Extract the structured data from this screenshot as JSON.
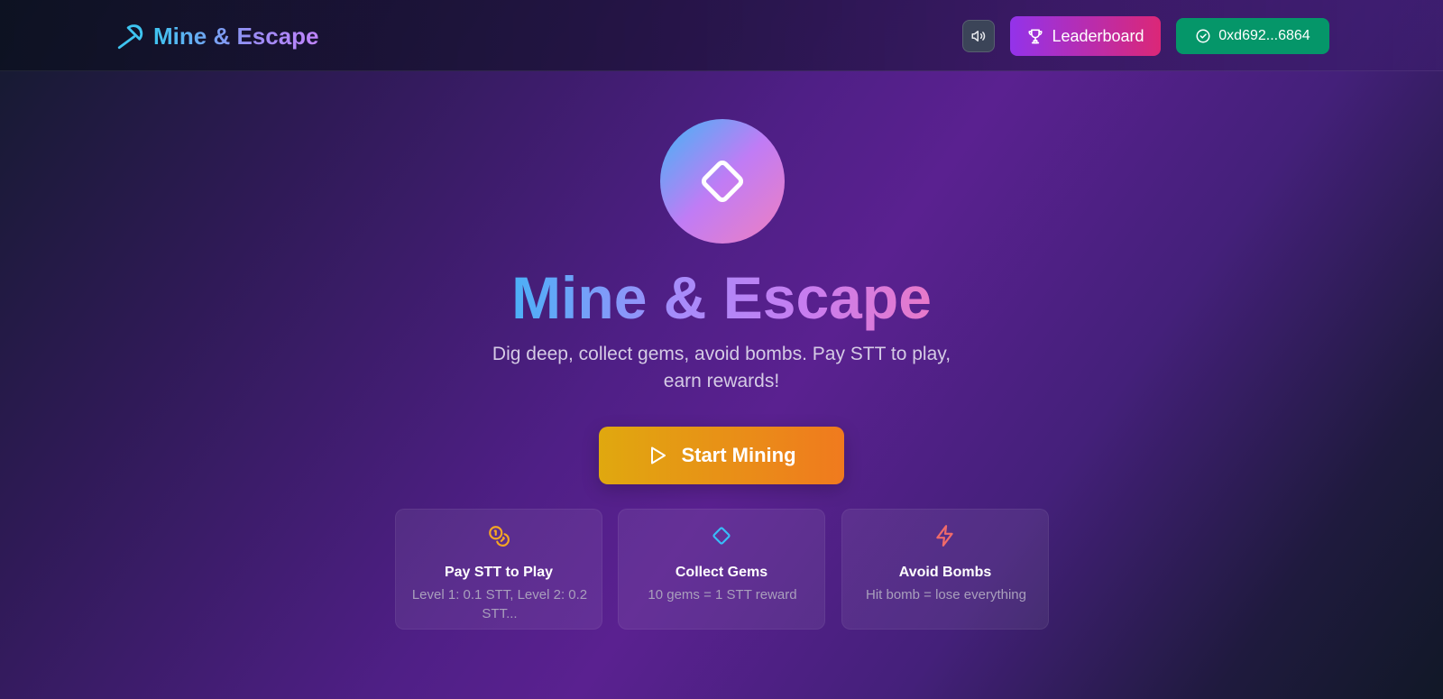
{
  "header": {
    "brand_title": "Mine & Escape",
    "brand_icon": "pickaxe-icon",
    "sound_icon": "speaker-icon",
    "leaderboard_label": "Leaderboard",
    "leaderboard_icon": "trophy-icon",
    "wallet_label": "0xd692...6864",
    "wallet_icon": "check-circle-icon"
  },
  "hero": {
    "logo_icon": "diamond-icon",
    "title": "Mine & Escape",
    "subtitle": "Dig deep, collect gems, avoid bombs. Pay STT to play, earn rewards!",
    "start_button_label": "Start Mining",
    "start_button_icon": "play-icon"
  },
  "features": [
    {
      "icon": "coins-icon",
      "title": "Pay STT to Play",
      "description": "Level 1: 0.1 STT, Level 2: 0.2 STT..."
    },
    {
      "icon": "gem-icon",
      "title": "Collect Gems",
      "description": "10 gems = 1 STT reward"
    },
    {
      "icon": "lightning-icon",
      "title": "Avoid Bombs",
      "description": "Hit bomb = lose everything"
    }
  ],
  "colors": {
    "brand_gradient_start": "#3ec4f0",
    "leaderboard_gradient": [
      "#9333ea",
      "#db2777"
    ],
    "wallet_green": "#059669",
    "start_gradient": [
      "#e0a80f",
      "#f07a1e"
    ],
    "coins_icon": "#f5a623",
    "gem_icon": "#38bdf8",
    "lightning_icon": "#f06a6a"
  }
}
